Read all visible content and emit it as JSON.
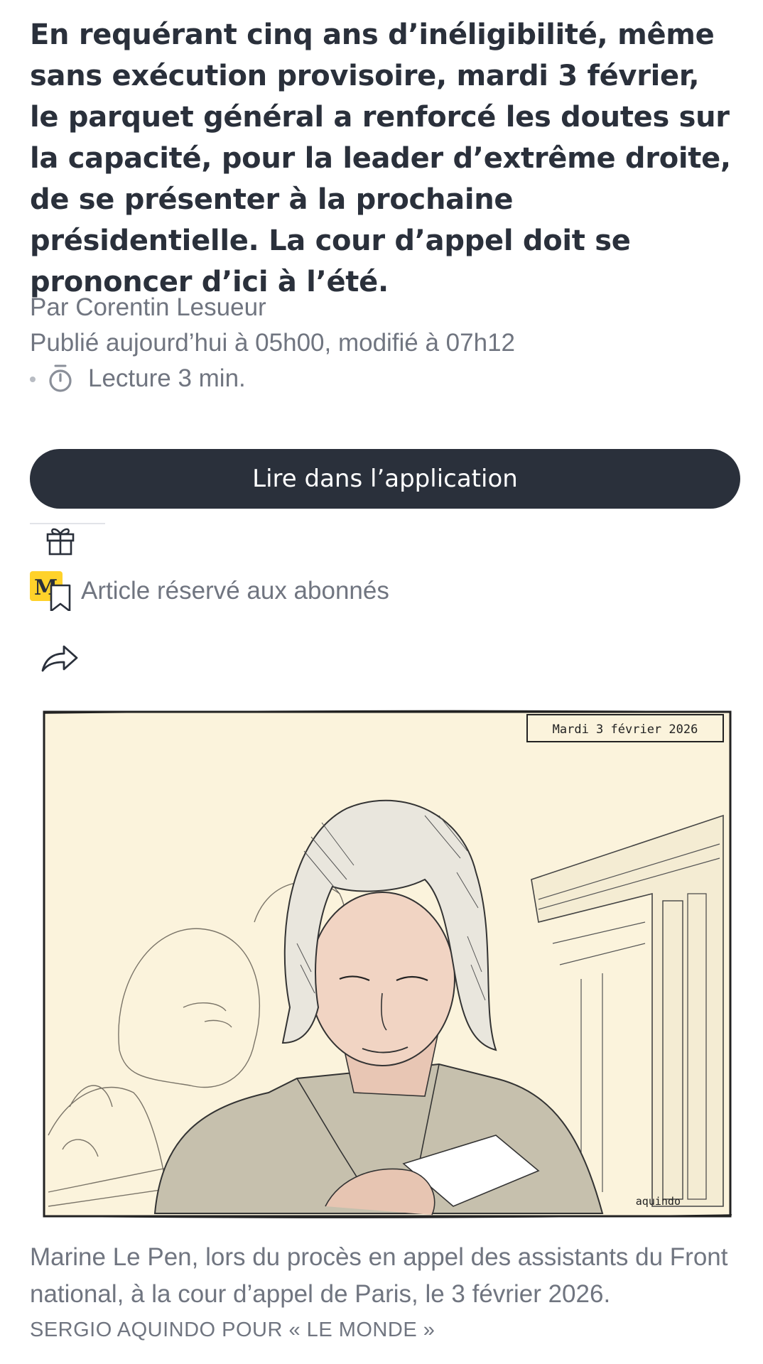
{
  "article": {
    "lede": "En requérant cinq ans d’inéligibilité, même sans exécution provisoire, mardi 3 février, le parquet général a renforcé les doutes sur la capacité, pour la leader d’extrême droite, de se présenter à la prochaine présidentielle. La cour d’appel doit se prononcer d’ici à l’été.",
    "author": "Par Corentin Lesueur",
    "published": "Publié aujourd’hui à 05h00, modifié à 07h12",
    "reading_time": "Lecture 3 min."
  },
  "actions": {
    "app_button_label": "Lire dans l’application",
    "subscriber_label": "Article réservé aux abonnés"
  },
  "illustration": {
    "date_banner": "Mardi 3 février 2026",
    "artist_signature": "aquindo"
  },
  "caption": {
    "text": "Marine Le Pen, lors du procès en appel des assistants du Front national, à la cour d’appel de Paris, le 3 février 2026.",
    "credit": "SERGIO AQUINDO POUR « LE MONDE »"
  },
  "icons": {
    "timer": "timer-icon",
    "gift": "gift-icon",
    "bookmark": "bookmark-icon",
    "share": "share-icon"
  },
  "colors": {
    "text": "#2a303b",
    "muted": "#707580",
    "button": "#2a303b",
    "badge": "#ffd22a",
    "paper": "#fbf3dc"
  }
}
